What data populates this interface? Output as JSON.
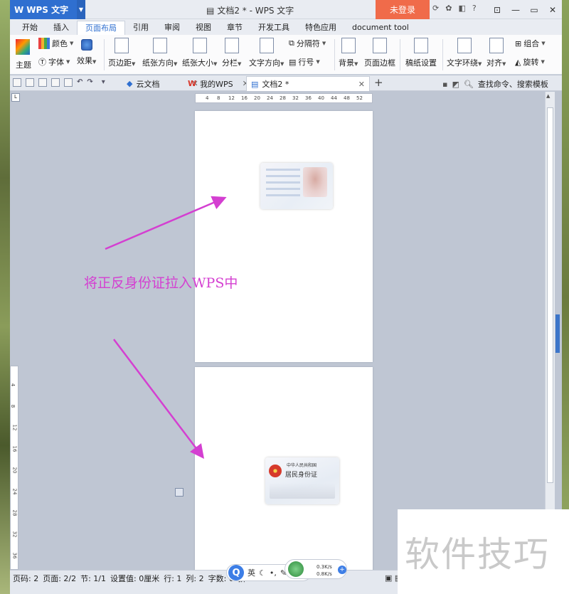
{
  "titlebar": {
    "app_button": "WPS 文字",
    "doc_title": "文档2 * - WPS 文字",
    "login_button": "未登录"
  },
  "menu": {
    "tabs": [
      "开始",
      "插入",
      "页面布局",
      "引用",
      "审阅",
      "视图",
      "章节",
      "开发工具",
      "特色应用",
      "document tool"
    ],
    "active": "页面布局"
  },
  "ribbon": {
    "theme": "主题",
    "color": "颜色",
    "font": "字体",
    "effect": "效果",
    "margins": "页边距",
    "orientation": "纸张方向",
    "size": "纸张大小",
    "columns": "分栏",
    "text_direction": "文字方向",
    "separator": "分隔符",
    "line_number": "行号",
    "background": "背景",
    "page_border": "页面边框",
    "manuscript": "稿纸设置",
    "wrap_text": "文字环绕",
    "align": "对齐",
    "group": "组合",
    "rotate": "旋转"
  },
  "doc_tabs": {
    "cloud": "云文档",
    "my_wps": "我的WPS",
    "current": "文档2 *"
  },
  "search_command": "查找命令、搜索模板",
  "ruler_ticks": [
    "4",
    "8",
    "12",
    "16",
    "20",
    "24",
    "28",
    "32",
    "36",
    "40",
    "44",
    "48",
    "52"
  ],
  "vruler_ticks": [
    "4",
    "8",
    "12",
    "16",
    "20",
    "24",
    "28",
    "32",
    "36"
  ],
  "annotation": "将正反身份证拉入WPS中",
  "id_back": {
    "country": "中华人民共和国",
    "name": "居民身份证"
  },
  "status": {
    "page_no": "页码: 2",
    "pages": "页面: 2/2",
    "section": "节: 1/1",
    "setting": "设置值: 0厘米",
    "line": "行: 1",
    "col": "列: 2",
    "words": "字数: 0",
    "tail": "拼"
  },
  "ime": {
    "logo": "Q",
    "lang": "英"
  },
  "net_speed": {
    "up": "0.3K/s",
    "down": "0.8K/s"
  },
  "watermark": "软件技巧",
  "colors": {
    "accent": "#2f6fd0",
    "login": "#f06b4a",
    "annotation": "#d43fd1"
  }
}
